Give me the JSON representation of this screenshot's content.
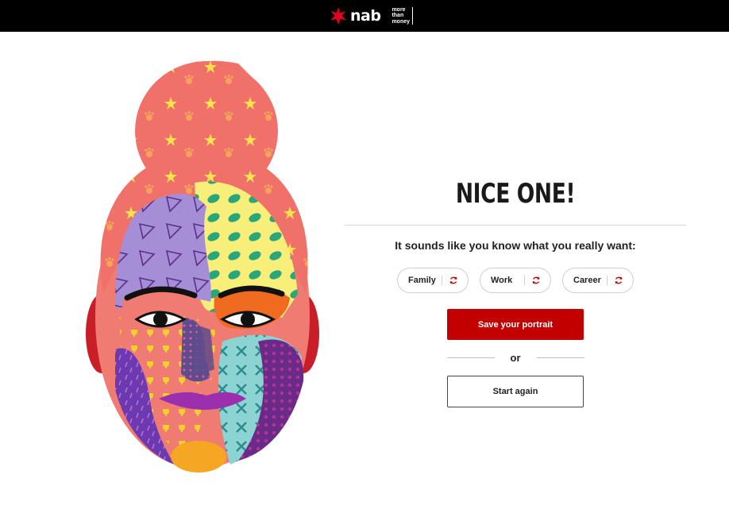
{
  "header": {
    "brand_name": "nab",
    "tagline_lines": [
      "more",
      "than",
      "money"
    ],
    "logo_icon": "red-star-icon",
    "background_color": "#000000"
  },
  "portrait": {
    "icon": "pop-art-face-illustration"
  },
  "result": {
    "headline": "NICE ONE!",
    "subtitle": "It sounds like you know what you really want:",
    "chips": [
      {
        "label": "Family",
        "icon": "refresh-icon"
      },
      {
        "label": "Work",
        "icon": "refresh-icon"
      },
      {
        "label": "Career",
        "icon": "refresh-icon"
      }
    ],
    "primary_button": "Save your portrait",
    "or_text": "or",
    "secondary_button": "Start again"
  },
  "colors": {
    "accent_red": "#c20000",
    "chip_border": "#cfcfcf",
    "divider": "#d7d7d7"
  }
}
